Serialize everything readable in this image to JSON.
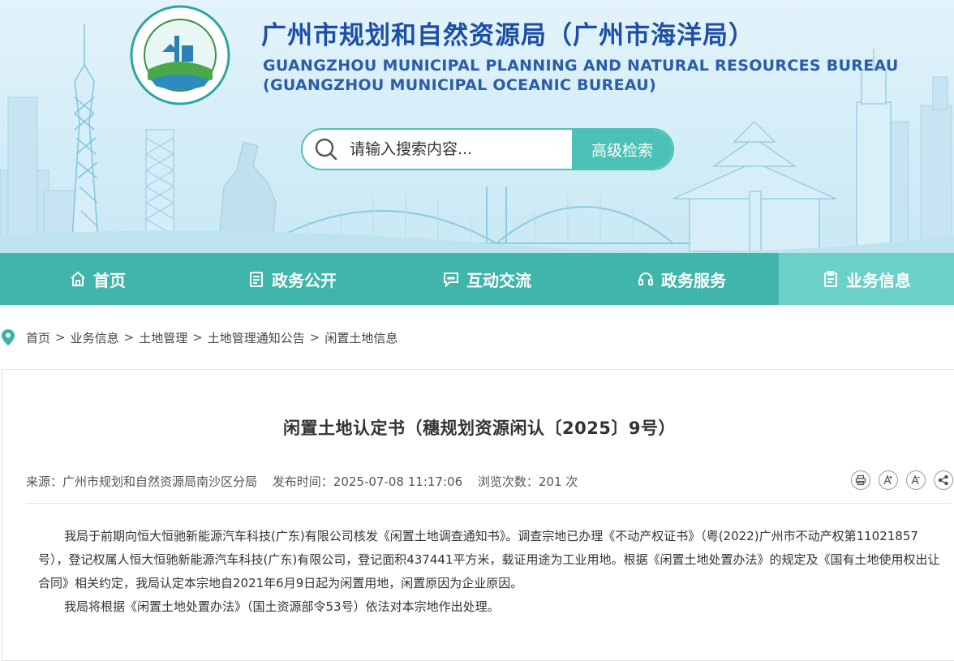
{
  "header": {
    "title_cn": "广州市规划和自然资源局（广州市海洋局）",
    "title_en_line1": "GUANGZHOU MUNICIPAL PLANNING AND NATURAL RESOURCES BUREAU",
    "title_en_line2": "(GUANGZHOU MUNICIPAL OCEANIC BUREAU)",
    "logo_text_top": "广州市规划和自然资源局",
    "logo_text_bottom": "GUANGZHOU MUNICIPAL PLANNING AND NATURAL RESOURCES BUREAU"
  },
  "search": {
    "placeholder": "请输入搜索内容...",
    "advanced_label": "高级检索"
  },
  "nav": {
    "items": [
      {
        "label": "首页",
        "icon": "home-icon"
      },
      {
        "label": "政务公开",
        "icon": "document-icon"
      },
      {
        "label": "互动交流",
        "icon": "chat-icon"
      },
      {
        "label": "政务服务",
        "icon": "headset-icon"
      },
      {
        "label": "业务信息",
        "icon": "clipboard-icon"
      }
    ],
    "active_index": 4
  },
  "breadcrumb": {
    "items": [
      "首页",
      "业务信息",
      "土地管理",
      "土地管理通知公告",
      "闲置土地信息"
    ],
    "separator": ">"
  },
  "article": {
    "title": "闲置土地认定书（穗规划资源闲认〔2025〕9号）",
    "source": "来源：广州市规划和自然资源局南沙区分局",
    "published": "发布时间：2025-07-08 11:17:06",
    "views": "浏览次数：201 次",
    "tools": [
      "print-icon",
      "font-increase-icon",
      "font-decrease-icon",
      "share-icon"
    ],
    "paragraphs": [
      "我局于前期向恒大恒驰新能源汽车科技(广东)有限公司核发《闲置土地调查通知书》。调查宗地已办理《不动产权证书》（粤(2022)广州市不动产权第11021857号），登记权属人恒大恒驰新能源汽车科技(广东)有限公司，登记面积437441平方米，载证用途为工业用地。根据《闲置土地处置办法》的规定及《国有土地使用权出让合同》相关约定，我局认定本宗地自2021年6月9日起为闲置用地，闲置原因为企业原因。",
      "我局将根据《闲置土地处置办法》（国土资源部令53号）依法对本宗地作出处理。"
    ]
  },
  "colors": {
    "nav_bg": "#3fb5ab",
    "nav_active": "#6bd0c8",
    "title_blue": "#1e4fa6",
    "search_button": "#4cc1b7"
  }
}
